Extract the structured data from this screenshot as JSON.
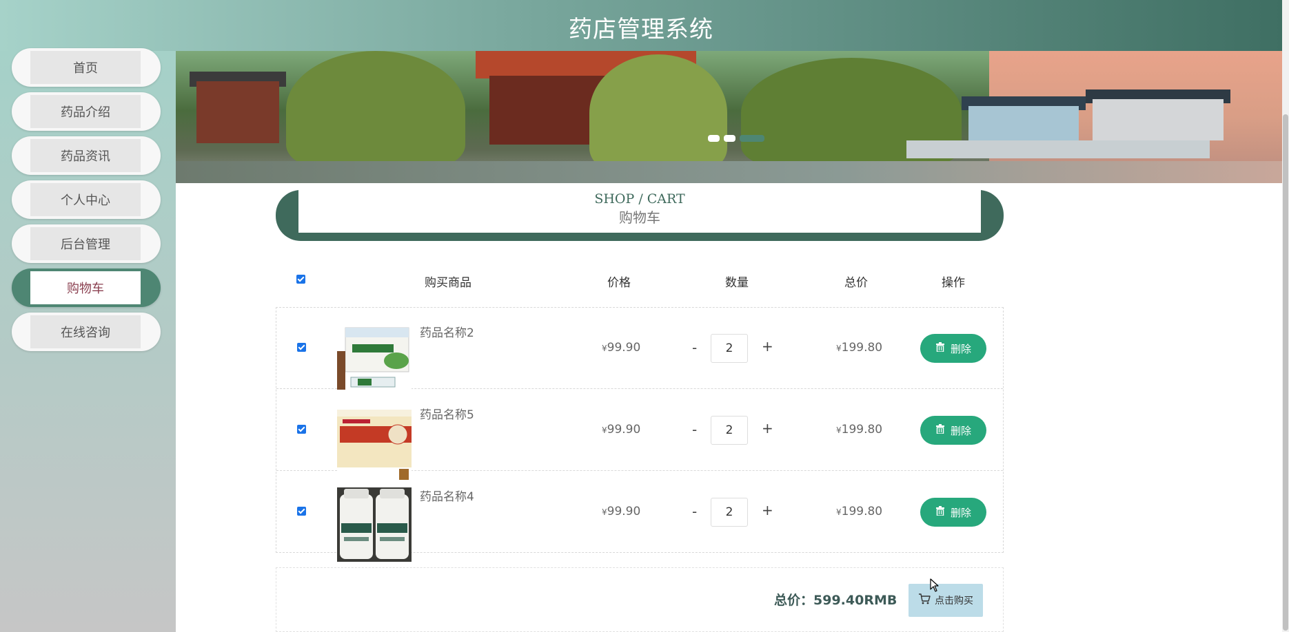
{
  "header": {
    "title": "药店管理系统"
  },
  "sidebar": {
    "items": [
      {
        "label": "首页",
        "active": false
      },
      {
        "label": "药品介绍",
        "active": false
      },
      {
        "label": "药品资讯",
        "active": false
      },
      {
        "label": "个人中心",
        "active": false
      },
      {
        "label": "后台管理",
        "active": false
      },
      {
        "label": "购物车",
        "active": true
      },
      {
        "label": "在线咨询",
        "active": false
      }
    ]
  },
  "banner": {
    "slide_count": 3,
    "active_slide": 3
  },
  "section": {
    "title_en": "SHOP / CART",
    "title_zh": "购物车"
  },
  "cart": {
    "columns": [
      "购买商品",
      "价格",
      "数量",
      "总价",
      "操作"
    ],
    "select_all": true,
    "currency_symbol": "¥",
    "rows": [
      {
        "name": "药品名称2",
        "price": "99.90",
        "qty": "2",
        "total": "199.80",
        "checked": true,
        "delete_label": "删除"
      },
      {
        "name": "药品名称5",
        "price": "99.90",
        "qty": "2",
        "total": "199.80",
        "checked": true,
        "delete_label": "删除"
      },
      {
        "name": "药品名称4",
        "price": "99.90",
        "qty": "2",
        "total": "199.80",
        "checked": true,
        "delete_label": "删除"
      }
    ],
    "qty_minus": "-",
    "qty_plus": "+"
  },
  "summary": {
    "total_text": "总价：599.40RMB",
    "buy_label": "点击购买"
  },
  "colors": {
    "accent": "#3f6a5c",
    "delete_button": "#27a87c",
    "buy_button": "#bcdce8",
    "active_nav_text": "#8a3f4f"
  }
}
